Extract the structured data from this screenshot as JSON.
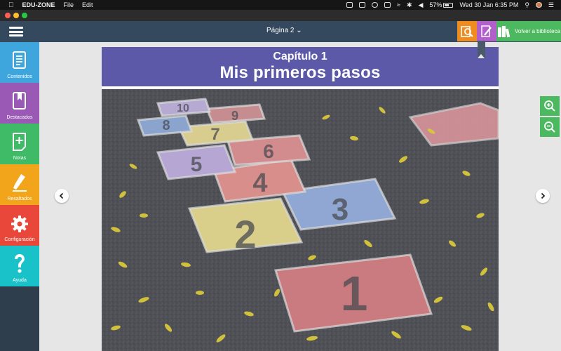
{
  "menubar": {
    "app_name": "EDU-ZONE",
    "menus": [
      "File",
      "Edit"
    ],
    "battery": "57%",
    "datetime": "Wed 30 Jan  6:35 PM"
  },
  "header": {
    "page_label": "Página 2",
    "library_label": "Volver a biblioteca"
  },
  "sidebar": {
    "items": [
      {
        "label": "Contenidos",
        "icon": "contents-icon",
        "color": "#3fa6dd"
      },
      {
        "label": "Destacados",
        "icon": "bookmark-icon",
        "color": "#9b59b6"
      },
      {
        "label": "Notas",
        "icon": "add-note-icon",
        "color": "#3fba67"
      },
      {
        "label": "Resaltados",
        "icon": "highlighter-icon",
        "color": "#f2a51b"
      },
      {
        "label": "Configuración",
        "icon": "gear-icon",
        "color": "#e9473a"
      },
      {
        "label": "Ayuda",
        "icon": "question-icon",
        "color": "#19c2c8"
      }
    ]
  },
  "page": {
    "chapter_label": "Capítulo 1",
    "chapter_title": "Mis primeros pasos",
    "hopscotch_numbers": [
      "10",
      "9",
      "8",
      "7",
      "6",
      "5",
      "4",
      "3",
      "2",
      "1"
    ]
  }
}
